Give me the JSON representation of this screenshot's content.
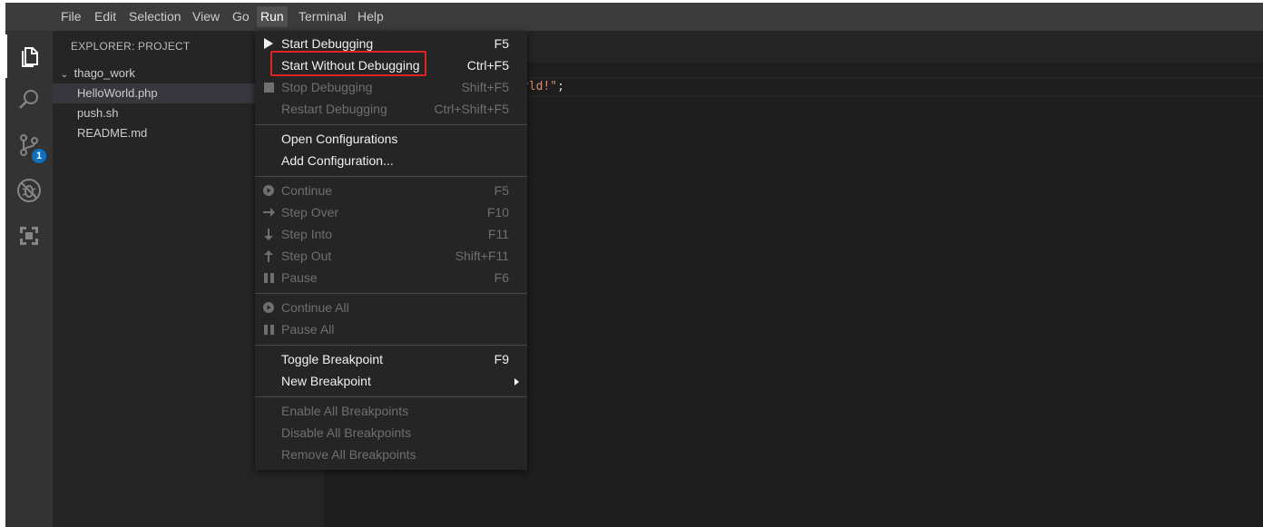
{
  "menubar": {
    "items": [
      {
        "label": "File"
      },
      {
        "label": "Edit"
      },
      {
        "label": "Selection"
      },
      {
        "label": "View"
      },
      {
        "label": "Go"
      },
      {
        "label": "Run",
        "active": true
      },
      {
        "label": "Terminal"
      },
      {
        "label": "Help"
      }
    ]
  },
  "activitybar": {
    "items": [
      {
        "icon": "files-icon",
        "selected": true
      },
      {
        "icon": "search-icon"
      },
      {
        "icon": "source-control-icon",
        "badge": "1"
      },
      {
        "icon": "no-bug-icon"
      },
      {
        "icon": "remote-explorer-icon"
      }
    ]
  },
  "sidebar": {
    "title": "EXPLORER: PROJECT",
    "folder": "thago_work",
    "files": [
      {
        "name": "HelloWorld.php",
        "selected": true
      },
      {
        "name": "push.sh"
      },
      {
        "name": "README.md"
      }
    ]
  },
  "editor": {
    "visible_code_string": "rld!\"",
    "visible_code_punct": ";"
  },
  "run_menu": {
    "groups": [
      [
        {
          "label": "Start Debugging",
          "key": "F5",
          "icon": "play-icon",
          "enabled": true
        },
        {
          "label": "Start Without Debugging",
          "key": "Ctrl+F5",
          "enabled": true,
          "highlighted": true
        },
        {
          "label": "Stop Debugging",
          "key": "Shift+F5",
          "icon": "stop-icon",
          "enabled": false
        },
        {
          "label": "Restart Debugging",
          "key": "Ctrl+Shift+F5",
          "enabled": false
        }
      ],
      [
        {
          "label": "Open Configurations",
          "key": "",
          "enabled": true
        },
        {
          "label": "Add Configuration...",
          "key": "",
          "enabled": true
        }
      ],
      [
        {
          "label": "Continue",
          "key": "F5",
          "icon": "continue-icon",
          "enabled": false
        },
        {
          "label": "Step Over",
          "key": "F10",
          "icon": "step-over-icon",
          "enabled": false
        },
        {
          "label": "Step Into",
          "key": "F11",
          "icon": "step-into-icon",
          "enabled": false
        },
        {
          "label": "Step Out",
          "key": "Shift+F11",
          "icon": "step-out-icon",
          "enabled": false
        },
        {
          "label": "Pause",
          "key": "F6",
          "icon": "pause-icon",
          "enabled": false
        }
      ],
      [
        {
          "label": "Continue All",
          "key": "",
          "icon": "continue-icon",
          "enabled": false
        },
        {
          "label": "Pause All",
          "key": "",
          "icon": "pause-icon",
          "enabled": false
        }
      ],
      [
        {
          "label": "Toggle Breakpoint",
          "key": "F9",
          "enabled": true
        },
        {
          "label": "New Breakpoint",
          "key": "",
          "enabled": true,
          "submenu": true
        }
      ],
      [
        {
          "label": "Enable All Breakpoints",
          "key": "",
          "enabled": false
        },
        {
          "label": "Disable All Breakpoints",
          "key": "",
          "enabled": false
        },
        {
          "label": "Remove All Breakpoints",
          "key": "",
          "enabled": false
        }
      ]
    ]
  },
  "colors": {
    "highlight_box": "#e02424",
    "badge": "#0e70c0"
  }
}
